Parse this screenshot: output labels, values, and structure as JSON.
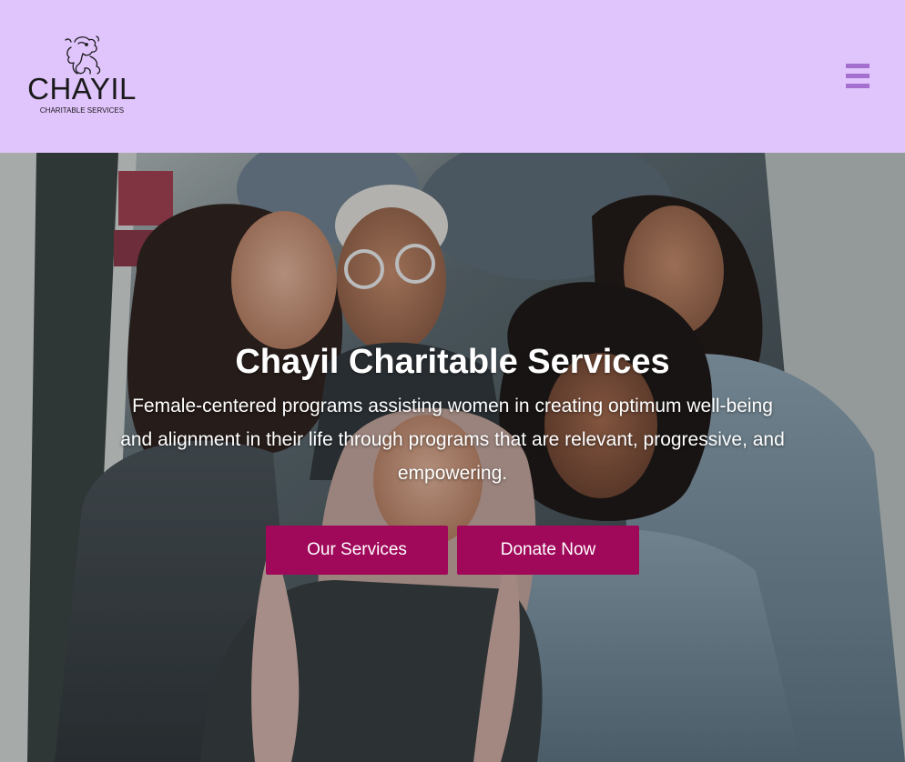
{
  "header": {
    "logo": {
      "icon": "lion-mascot-icon",
      "wordmark": "CHAYIL",
      "tagline": "CHARITABLE SERVICES"
    },
    "menu_icon": "hamburger-menu-icon",
    "background_color": "#e0c4fc",
    "menu_color": "#a56fd0"
  },
  "hero": {
    "image": "group-of-smiling-women-on-stairs-photo",
    "title": "Chayil Charitable Services",
    "subtitle": "Female-centered programs assisting women in creating optimum well-being and alignment in their life through programs that are relevant, progressive, and empowering.",
    "buttons": {
      "services_label": "Our Services",
      "donate_label": "Donate Now"
    },
    "button_color": "#a0085a"
  }
}
